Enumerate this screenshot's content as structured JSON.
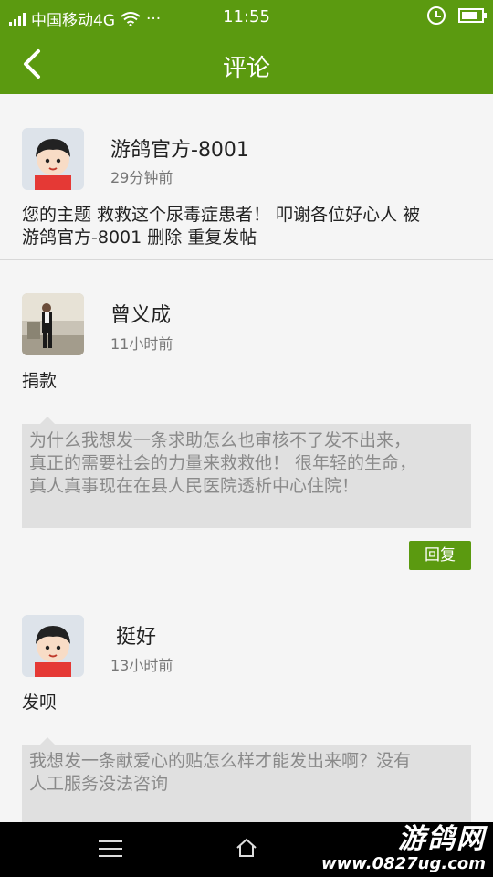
{
  "status_bar": {
    "carrier": "中国移动4G",
    "dots": "···",
    "time": "11:55"
  },
  "header": {
    "title": "评论"
  },
  "notice": {
    "name": "游鸽官方-8001",
    "time": "29分钟前",
    "text_line1": "您的主题 救救这个尿毒症患者！ 叩谢各位好心人 被",
    "text_line2": "游鸽官方-8001 删除 重复发帖"
  },
  "comments": [
    {
      "name": "曾义成",
      "time": "11小时前",
      "text": "捐款",
      "quote_line1": "为什么我想发一条求助怎么也审核不了发不出来，",
      "quote_line2": "真正的需要社会的力量来救救他！ 很年轻的生命，",
      "quote_line3": "真人真事现在在县人民医院透析中心住院！",
      "reply_label": "回复"
    },
    {
      "name": "挺好",
      "time": "13小时前",
      "text": "发呗",
      "quote_line1": "我想发一条献爱心的贴怎么样才能发出来啊？没有",
      "quote_line2": "人工服务没法咨询"
    }
  ],
  "watermark": {
    "brand": "游鸽网",
    "url": "www.0827ug.com"
  },
  "colors": {
    "accent": "#5b9a10",
    "navbar": "#000000",
    "quote_bg": "#e0e0e0"
  }
}
